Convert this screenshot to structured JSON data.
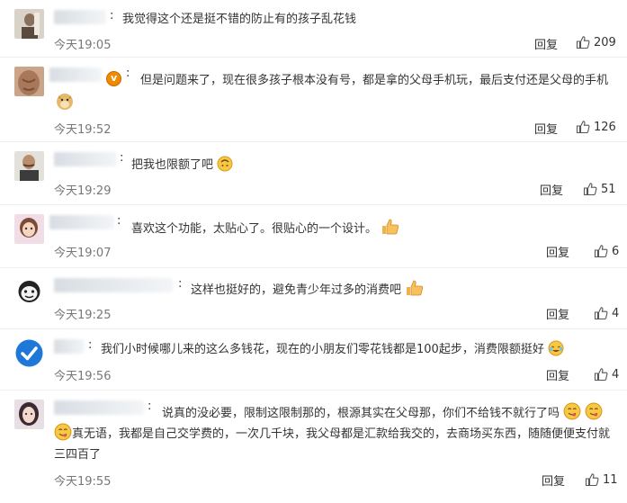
{
  "actions": {
    "reply_label": "回复"
  },
  "comments": [
    {
      "text": "我觉得这个还是挺不错的防止有的孩子乱花钱",
      "time": "今天19:05",
      "likes": "209"
    },
    {
      "text": "但是问题来了，现在很多孩子根本没有号，都是拿的父母手机玩，最后支付还是父母的手机",
      "time": "今天19:52",
      "likes": "126"
    },
    {
      "text": "把我也限额了吧",
      "time": "今天19:29",
      "likes": "51"
    },
    {
      "text": "喜欢这个功能，太贴心了。很贴心的一个设计。",
      "time": "今天19:07",
      "likes": "6"
    },
    {
      "text": "这样也挺好的，避免青少年过多的消费吧",
      "time": "今天19:25",
      "likes": "4"
    },
    {
      "text": "我们小时候哪儿来的这么多钱花，现在的小朋友们零花钱都是100起步，消费限额挺好",
      "time": "今天19:56",
      "likes": "4"
    },
    {
      "text": "说真的没必要，限制这限制那的，根源其实在父母那，你们不给钱不就行了吗",
      "text2": "真无语，我都是自己交学费的，一次几千块，我父母都是汇款给我交的，去商场买东西，随随便便支付就",
      "text3": "三四百了",
      "time": "今天19:55",
      "likes": "11"
    }
  ],
  "colors": {
    "text": "#333333",
    "time": "#777777",
    "divider": "#eeeeee",
    "vip_badge": "#f08a00"
  },
  "icons": {
    "like": "thumbs-up-icon",
    "vip": "vip-badge-icon"
  }
}
